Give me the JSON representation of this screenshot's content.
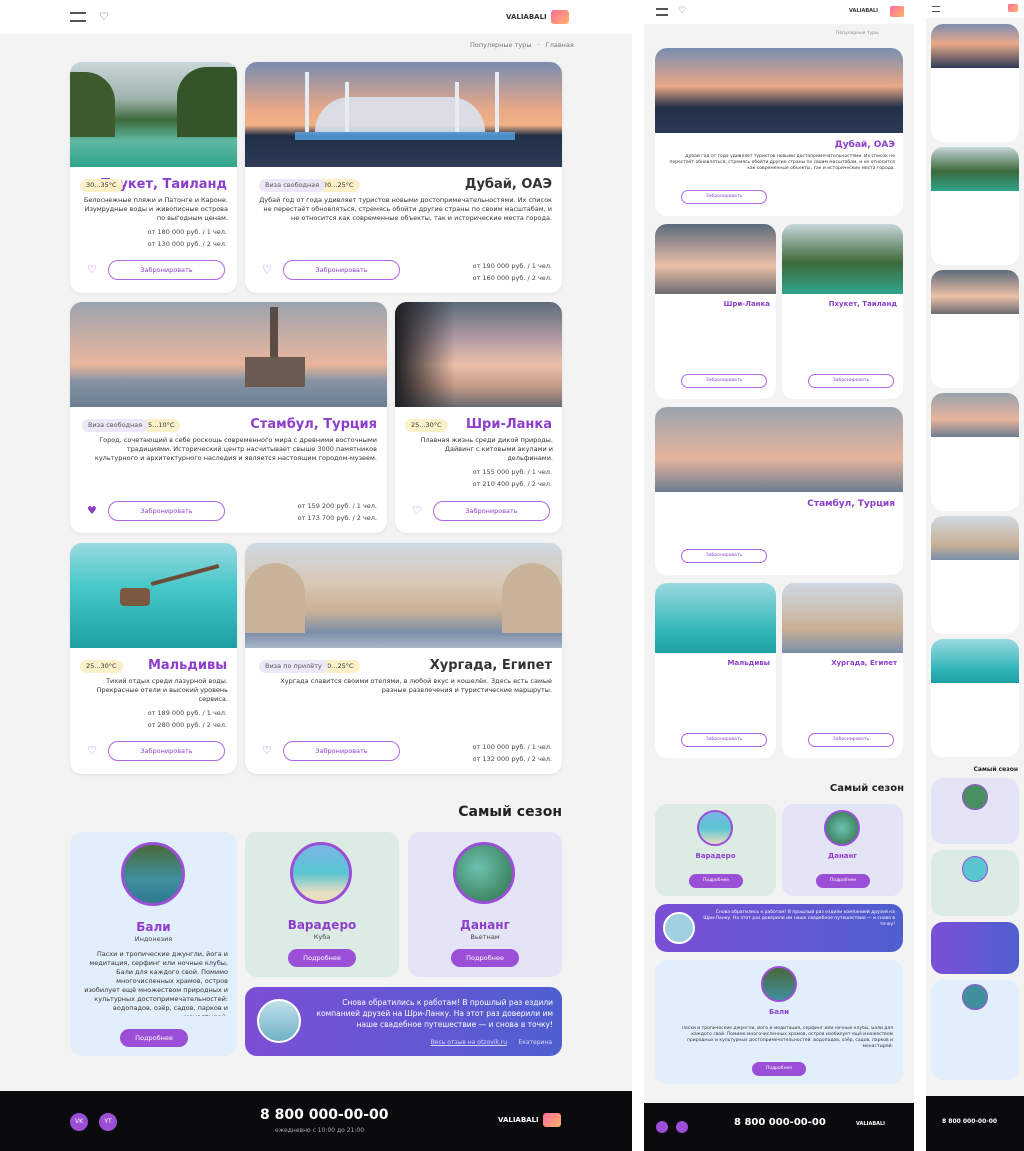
{
  "brand": {
    "logo_text": "VALIABALI",
    "accent": "#9b4fd6",
    "dark": "#0b0b0e"
  },
  "nav": {
    "breadcrumb_home": "Главная",
    "breadcrumb_sep": "·",
    "breadcrumb_current": "Популярные туры"
  },
  "tours": [
    {
      "id": "phuket",
      "title": "Пхукет, Таиланд",
      "temp": "30...35°C",
      "tag": "",
      "desc": "Белоснежные пляжи и Патонге и Кароне. Изумрудные воды и живописные острова по выгодным ценам.",
      "price1": "от 180 000 руб. / 1 чел.",
      "price2": "от 130 000 руб. / 2 чел.",
      "btn": "Забронировать",
      "liked": false
    },
    {
      "id": "dubai",
      "title": "Дубай, ОАЭ",
      "temp": "20...25°C",
      "tag": "Виза свободная",
      "desc": "Дубай год от года удивляет туристов новыми достопримечательностями. Их список не перестаёт обновляться, стремясь обойти другие страны по своим масштабам, и не относится как современные объекты, так и исторические места города.",
      "price1": "от 190 000 руб. / 1 чел.",
      "price2": "от 160 000 руб. / 2 чел.",
      "btn": "Забронировать",
      "liked": false
    },
    {
      "id": "srilanka",
      "title": "Шри-Ланка",
      "temp": "25...30°C",
      "tag": "",
      "desc": "Плавная жизнь среди дикой природы. Дайвинг с китовыми акулами и дельфинами.",
      "price1": "от 155 000 руб. / 1 чел.",
      "price2": "от 210 400 руб. / 2 чел.",
      "btn": "Забронировать",
      "liked": false
    },
    {
      "id": "istanbul",
      "title": "Стамбул, Турция",
      "temp": "5...10°C",
      "tag": "Виза свободная",
      "desc": "Город, сочетающий в себе роскошь современного мира с древними восточными традициями. Исторический центр насчитывает свыше 3000 памятников культурного и архитектурного наследия и является настоящим городом-музеем.",
      "price1": "от 159 200 руб. / 1 чел.",
      "price2": "от 173 700 руб. / 2 чел.",
      "btn": "Забронировать",
      "liked": true
    },
    {
      "id": "maldives",
      "title": "Мальдивы",
      "temp": "25...30°C",
      "tag": "",
      "desc": "Тихий отдых среди лазурной воды. Прекрасные отели и высокий уровень сервиса.",
      "price1": "от 189 000 руб. / 1 чел.",
      "price2": "от 280 000 руб. / 2 чел.",
      "btn": "Забронировать",
      "liked": false
    },
    {
      "id": "hurghada",
      "title": "Хургада, Египет",
      "temp": "20...25°C",
      "tag": "Виза по прилёту",
      "desc": "Хургада славится своими отелями, в любой вкус и кошелёк. Здесь есть самые разные развлечения и туристические маршруты.",
      "price1": "от 100 000 руб. / 1 чел.",
      "price2": "от 132 000 руб. / 2 чел.",
      "btn": "Забронировать",
      "liked": false
    }
  ],
  "season": {
    "heading": "Самый сезон",
    "items": [
      {
        "id": "danang",
        "title": "Дананг",
        "sub": "Вьетнам",
        "btn": "Подробнее"
      },
      {
        "id": "varadero",
        "title": "Варадеро",
        "sub": "Куба",
        "btn": "Подробнее"
      },
      {
        "id": "bali",
        "title": "Бали",
        "sub": "Индонезия",
        "desc": "Пасхи и тропические джунгли, йога и медитация, серфинг или ночные клубы, Бали для каждого свой. Помимо многочисленных храмов, остров изобилует ещё множеством природных и культурных достопримечательностей: водопадов, озёр, садов, парков и монастырей.",
        "btn": "Подробнее"
      }
    ],
    "review": {
      "text": "Снова обратились к работам! В прошлый раз ездили компанией друзей на Шри-Ланку. На этот раз доверили им наше свадебное путешествие — и снова в точку!",
      "author": "Екатерина",
      "link": "Весь отзыв на otzovik.ru"
    }
  },
  "footer": {
    "phone": "8 800 000-00-00",
    "hours": "ежедневно с 10:00 до 21:00",
    "social1": "VK",
    "social2": "YT"
  }
}
